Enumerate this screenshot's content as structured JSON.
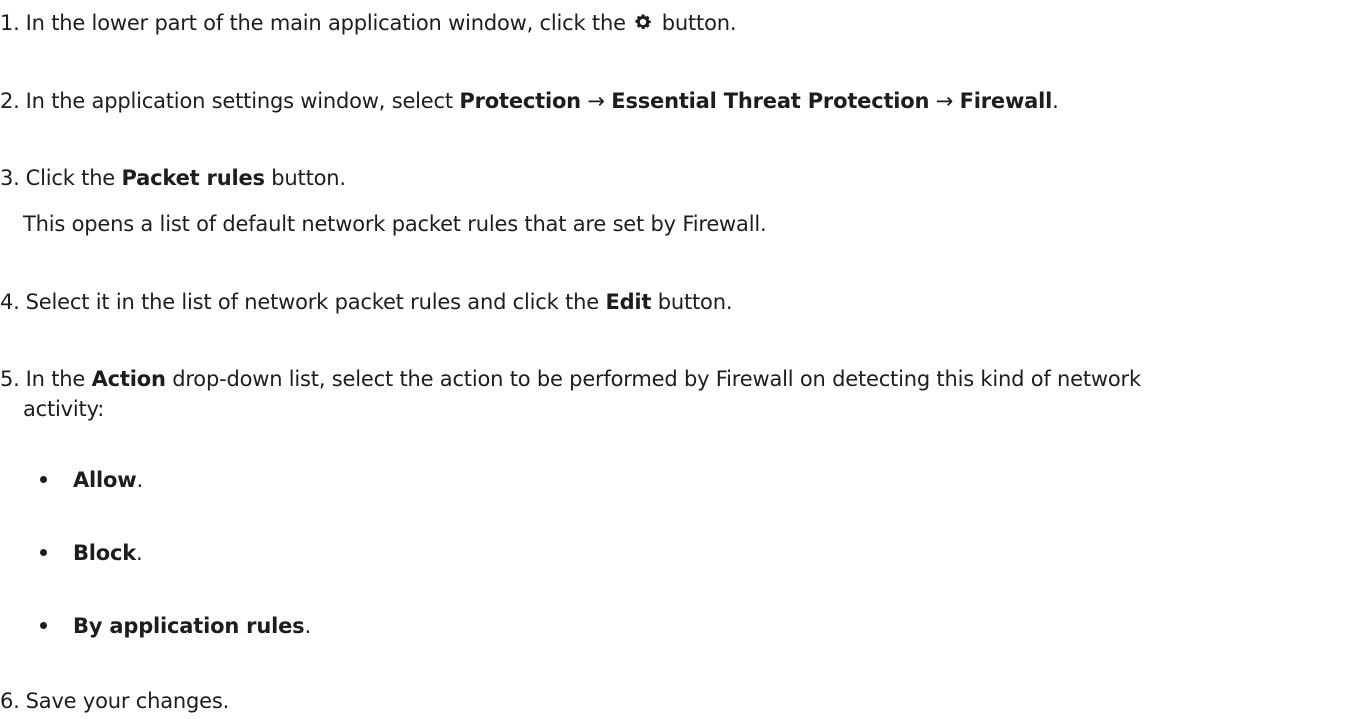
{
  "steps": [
    {
      "number": "1.",
      "before": "In the lower part of the main application window, click the",
      "after": "button.",
      "icon": "gear-icon"
    },
    {
      "number": "2.",
      "before": "In the application settings window, select",
      "b1": "Protection",
      "arrow1": " → ",
      "b2": "Essential Threat Protection",
      "arrow2": " → ",
      "b3": "Firewall",
      "end": "."
    },
    {
      "number": "3.",
      "before": "Click the",
      "b1": "Packet rules",
      "after": "button.",
      "note": "This opens a list of default network packet rules that are set by Firewall."
    },
    {
      "number": "4.",
      "before": "Select it in the list of network packet rules and click the",
      "b1": "Edit",
      "after": "button."
    },
    {
      "number": "5.",
      "before": "In the",
      "b1": "Action",
      "after": "drop-down list, select the action to be performed by Firewall on detecting this kind of network",
      "cont": "activity:",
      "options": [
        {
          "label": "Allow",
          "end": "."
        },
        {
          "label": "Block",
          "end": "."
        },
        {
          "label": "By application rules",
          "end": "."
        }
      ]
    },
    {
      "number": "6.",
      "before": "Save your changes."
    }
  ]
}
